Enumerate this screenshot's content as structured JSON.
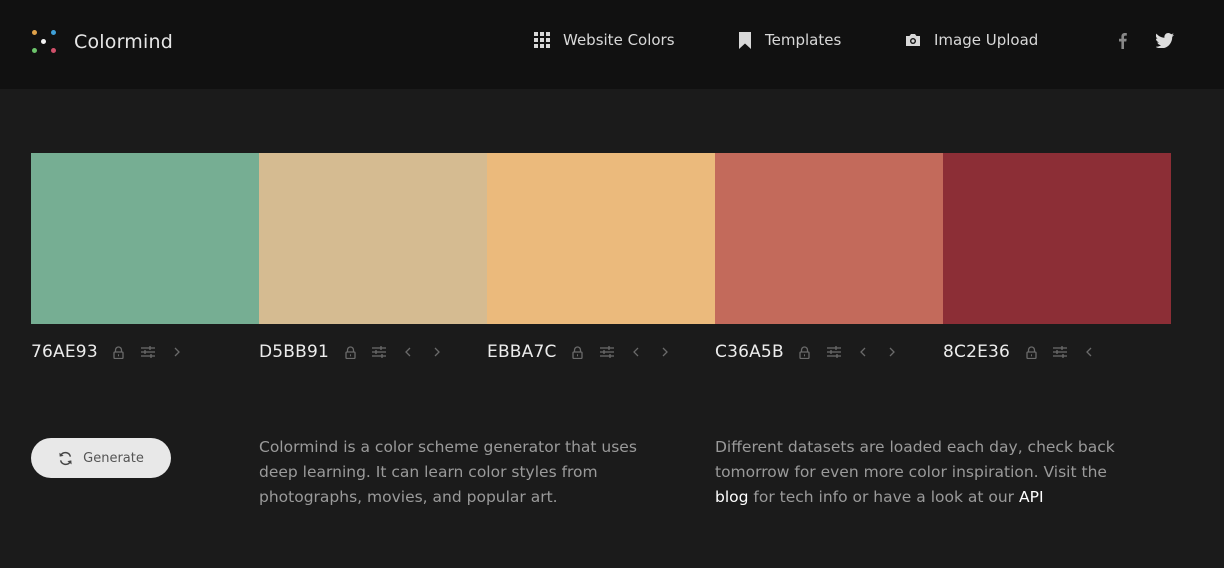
{
  "header": {
    "brand": "Colormind",
    "nav": [
      {
        "label": "Website Colors",
        "icon": "grid-icon"
      },
      {
        "label": "Templates",
        "icon": "bookmark-icon"
      },
      {
        "label": "Image Upload",
        "icon": "camera-icon"
      }
    ],
    "social": [
      {
        "icon": "facebook-icon"
      },
      {
        "icon": "twitter-icon"
      }
    ]
  },
  "palette": {
    "swatches": [
      {
        "hex": "76AE93",
        "color": "#76AE93"
      },
      {
        "hex": "D5BB91",
        "color": "#D5BB91"
      },
      {
        "hex": "EBBA7C",
        "color": "#EBBA7C"
      },
      {
        "hex": "C36A5B",
        "color": "#C36A5B"
      },
      {
        "hex": "8C2E36",
        "color": "#8C2E36"
      }
    ]
  },
  "actions": {
    "generate_label": "Generate"
  },
  "content": {
    "intro": "Colormind is a color scheme generator that uses deep learning. It can learn color styles from photographs, movies, and popular art.",
    "datasets_text": "Different datasets are loaded each day, check back tomorrow for even more color inspiration. Visit the",
    "blog_link": "blog",
    "tech_text": "for tech info or have a look at our",
    "api_link": "API"
  },
  "colors": {
    "page_bg": "#1b1b1b",
    "header_bg": "#111111",
    "text_muted": "#9a9a9a",
    "icon_muted": "#6a6a6a"
  }
}
